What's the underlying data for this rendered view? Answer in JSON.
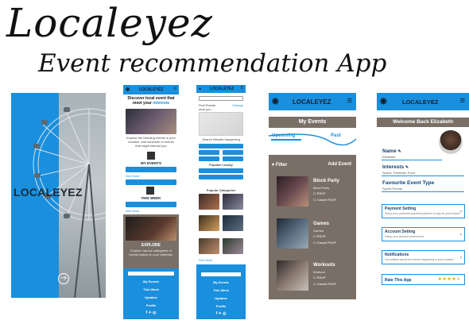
{
  "title": "Localeyez",
  "subtitle": "Event recommendation App",
  "splash": {
    "logo": "LOCALEYEZ",
    "next_icon": "arrow-right-icon"
  },
  "home": {
    "app_name": "LOCALEYEZ",
    "headline": "Discover local event that meet your",
    "headline_accent": "interests",
    "intro": "Explore the trending events in your location, and schedule to events that might interest you",
    "my_events": "MY EVENTS",
    "this_week": "THIS WEEK",
    "see_more": "See More",
    "explore": "EXPLORE",
    "explore_body": "Explore various categories of events based on your interests.",
    "footer_links": [
      "My Events",
      "This Week",
      "Updates",
      "Profile"
    ]
  },
  "search": {
    "app_name": "LOCALEYEZ",
    "placeholder": "Search events",
    "near_you": "Find Events near you",
    "change": "Change",
    "results_label": "Search Results Happening",
    "popular": "Popular Locally",
    "popular_categories": "Popular Categories",
    "footer_links": [
      "My Events",
      "This Week",
      "Updates",
      "Profile"
    ]
  },
  "my_events": {
    "app_name": "LOCALEYEZ",
    "heading": "My Events",
    "tab_upcoming": "Upcoming",
    "tab_past": "Past",
    "filter": "Filter",
    "add_event": "Add Event",
    "rsvp": "RSVP",
    "events": [
      {
        "name": "Block Party",
        "category": "Block Party",
        "opt2": "Cancel RSVP"
      },
      {
        "name": "Games",
        "category": "Games",
        "opt2": "Cancel RSVP"
      },
      {
        "name": "Workouts",
        "category": "Workout",
        "opt2": "Cancel RSVP"
      }
    ]
  },
  "profile": {
    "app_name": "LOCALEYEZ",
    "welcome": "Welcome Back Elizabeth",
    "name_label": "Name",
    "name_value": "Elizabeth",
    "interests_label": "Interests",
    "interests_value": "Sports, Festivals, Food",
    "fav_label": "Favourite Event Type",
    "fav_value": "Sports Events",
    "settings": [
      {
        "title": "Payment Setting",
        "desc": "Setup your preferred payment platform to pay for your tickets"
      },
      {
        "title": "Account Setting",
        "desc": "Setup your account preferences"
      },
      {
        "title": "Notifications",
        "desc": "Get notified about the events happening in your location"
      }
    ],
    "rate": "Rate This App",
    "stars": 4.5,
    "colors": {
      "accent": "#1a8fdd",
      "panel": "#7a6f66",
      "dark_text": "#123f73"
    }
  }
}
